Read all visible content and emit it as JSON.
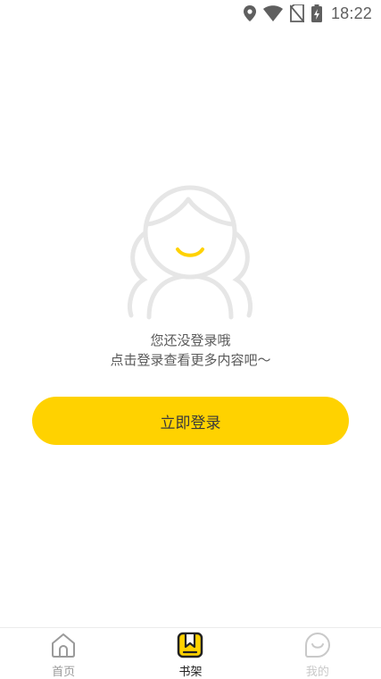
{
  "status_bar": {
    "time": "18:22",
    "icons": [
      "location-icon",
      "wifi-icon",
      "no-sim-icon",
      "battery-charging-icon"
    ]
  },
  "empty_state": {
    "illustration": "smiling-face-icon",
    "line1": "您还没登录哦",
    "line2": "点击登录查看更多内容吧～"
  },
  "login_button": {
    "label": "立即登录"
  },
  "colors": {
    "accent": "#ffd200",
    "icon_gray": "#e6e6e6",
    "text_gray": "#5a5a5a"
  },
  "tab_bar": {
    "tabs": [
      {
        "label": "首页",
        "icon": "home-icon",
        "state": "normal"
      },
      {
        "label": "书架",
        "icon": "bookshelf-icon",
        "state": "active"
      },
      {
        "label": "我的",
        "icon": "profile-smile-icon",
        "state": "disabled"
      }
    ]
  }
}
